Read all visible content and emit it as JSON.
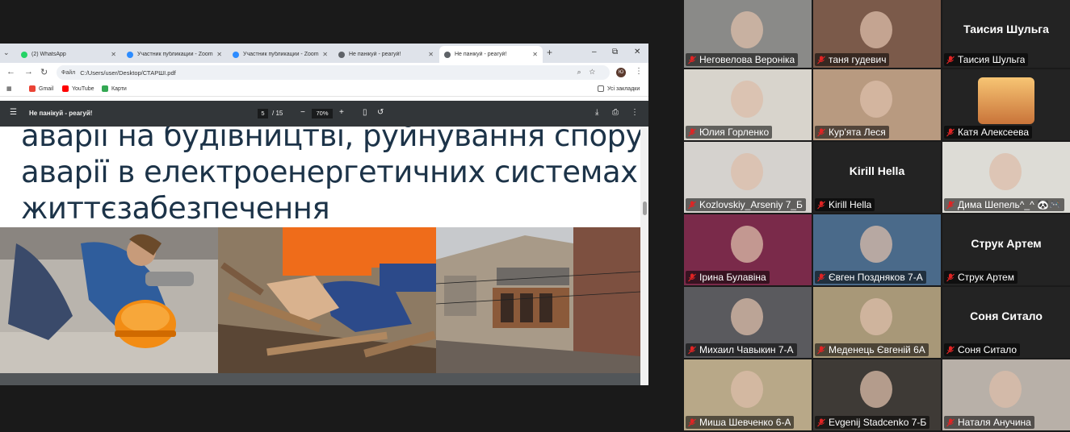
{
  "browser": {
    "tabs": [
      {
        "title": "(2) WhatsApp",
        "color": "#25d366",
        "active": false
      },
      {
        "title": "Участник публикации - Zoom",
        "color": "#2d8cff",
        "active": false
      },
      {
        "title": "Участник публикации - Zoom",
        "color": "#2d8cff",
        "active": false
      },
      {
        "title": "Не панікуй - реагуй!",
        "color": "#5f6368",
        "active": false
      },
      {
        "title": "Не панікуй - реагуй!",
        "color": "#5f6368",
        "active": true
      }
    ],
    "new_tab_label": "+",
    "window_controls": [
      "–",
      "⧉",
      "✕"
    ],
    "url_scheme": "Файл",
    "url": "C:/Users/user/Desktop/СТАРШІ.pdf",
    "profile_initial": "Ю",
    "bookmarks": [
      {
        "label": "Gmail",
        "color": "#ea4335"
      },
      {
        "label": "YouTube",
        "color": "#ff0000"
      },
      {
        "label": "Карти",
        "color": "#34a853"
      }
    ],
    "all_bookmarks_label": "Усі закладки"
  },
  "pdf": {
    "title": "Не панікуй - реагуй!",
    "page_current": "5",
    "page_total": "/ 15",
    "zoom": "70%",
    "slide_lines": [
      "аварії на будівництві, руйнування споруд,",
      "аварії в електроенергетичних системах",
      "життєзабезпечення"
    ]
  },
  "participants": [
    {
      "name": "Неговелова Вероніка",
      "video": true,
      "bg": "#8a8a88"
    },
    {
      "name": "таня гудевич",
      "video": true,
      "bg": "#7b5a4a"
    },
    {
      "name": "Таисия Шульга",
      "video": false,
      "display": "Таисия Шульга"
    },
    {
      "name": "Юлия Горленко",
      "video": true,
      "bg": "#d8d4cc",
      "active_speaker": true
    },
    {
      "name": "Кур'ята Леся",
      "video": true,
      "bg": "#b89a80"
    },
    {
      "name": "Катя Алексеева",
      "video": true,
      "bg": "#232323",
      "avatar": true
    },
    {
      "name": "Kozlovskiy_Arseniy 7_Б",
      "video": true,
      "bg": "#d5d2ce"
    },
    {
      "name": "Kirill Hella",
      "video": false,
      "display": "Kirill Hella"
    },
    {
      "name": "Дима Шепель^_^ 🐼🎮",
      "video": true,
      "bg": "#dddcd6"
    },
    {
      "name": "Ірина Булавіна",
      "video": true,
      "bg": "#7a2a4a"
    },
    {
      "name": "Євген Поздняков 7-А",
      "video": true,
      "bg": "#4a6a8a"
    },
    {
      "name": "Струк Артем",
      "video": false,
      "display": "Струк Артем"
    },
    {
      "name": "Михаил Чавыкин 7-А",
      "video": true,
      "bg": "#5a5a5e"
    },
    {
      "name": "Меденець Євгеній 6А",
      "video": true,
      "bg": "#a89878"
    },
    {
      "name": "Соня Ситало",
      "video": false,
      "display": "Соня Ситало"
    },
    {
      "name": "Миша Шевченко 6-А",
      "video": true,
      "bg": "#b8a888"
    },
    {
      "name": "Evgenij Stadcenko 7-Б",
      "video": true,
      "bg": "#3e3a36"
    },
    {
      "name": "Наталя Анучина",
      "video": true,
      "bg": "#b8b0a8"
    }
  ],
  "colors": {
    "accent_speaker": "#22c55e",
    "mic_muted": "#e02424",
    "slide_text": "#1c3348"
  }
}
